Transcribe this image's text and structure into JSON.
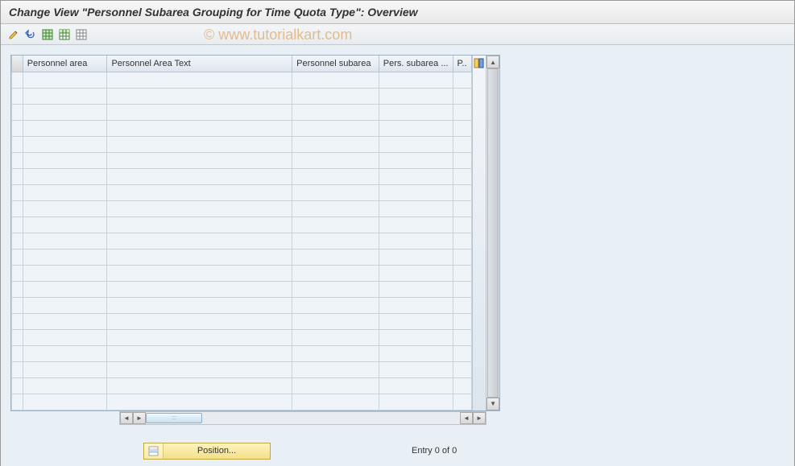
{
  "header": {
    "title": "Change View \"Personnel Subarea Grouping for Time Quota Type\": Overview"
  },
  "toolbar": {
    "tools": [
      "edit",
      "undo",
      "select-all",
      "select-block",
      "deselect-all"
    ]
  },
  "table": {
    "columns": [
      {
        "label": "Personnel area"
      },
      {
        "label": "Personnel Area Text"
      },
      {
        "label": "Personnel subarea"
      },
      {
        "label": "Pers. subarea ..."
      },
      {
        "label": "P.."
      }
    ],
    "row_count": 21
  },
  "footer": {
    "position_label": "Position...",
    "entry_text": "Entry 0 of 0"
  },
  "watermark": "© www.tutorialkart.com"
}
